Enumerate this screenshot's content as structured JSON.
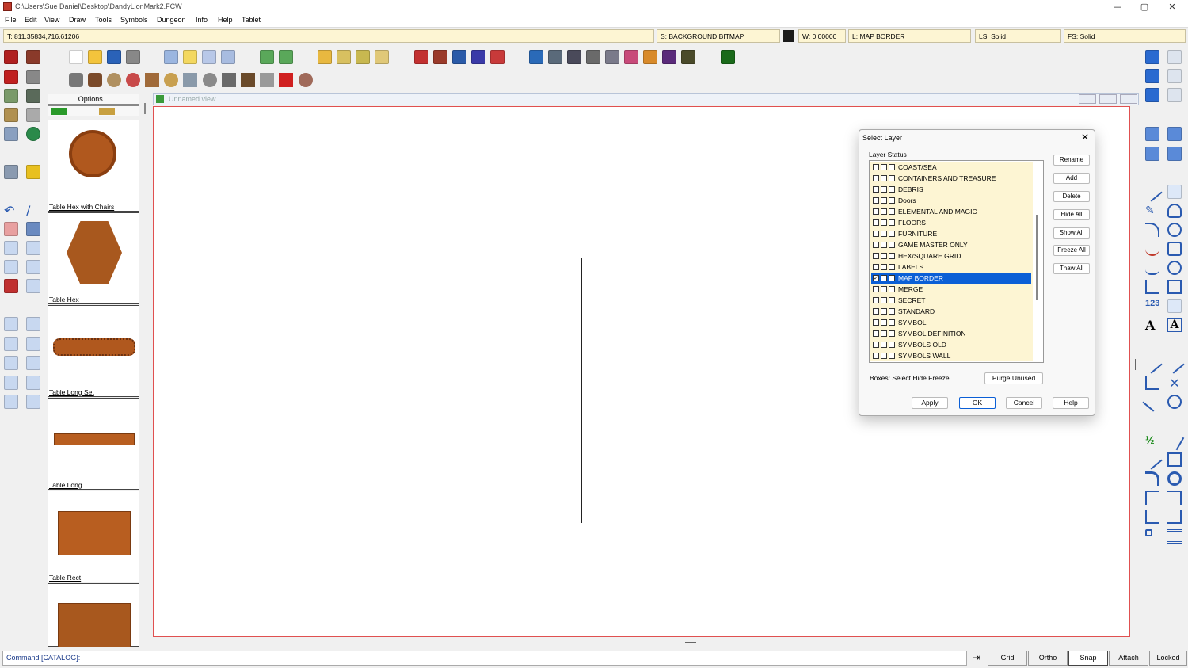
{
  "window": {
    "title": "C:\\Users\\Sue Daniel\\Desktop\\DandyLionMark2.FCW",
    "minimize": "—",
    "maximize": "▢",
    "close": "✕"
  },
  "menu": [
    "File",
    "Edit",
    "View",
    "Draw",
    "Tools",
    "Symbols",
    "Dungeon",
    "Info",
    "Help",
    "Tablet"
  ],
  "status": {
    "coords": "T: 811.35834,716.61206",
    "sheet": "S: BACKGROUND BITMAP",
    "width": "W: 0.00000",
    "layer": "L: MAP BORDER",
    "line_style": "LS: Solid",
    "fill_style": "FS: Solid",
    "color_swatch": "#1a1a1a"
  },
  "catalog": {
    "options_label": "Options...",
    "items": [
      "Table Hex with Chairs",
      "Table Hex",
      "Table Long Set",
      "Table Long",
      "Table Rect"
    ]
  },
  "view": {
    "title": "Unnamed view"
  },
  "dialog": {
    "title": "Select Layer",
    "group_label": "Layer Status",
    "layers": [
      "COAST/SEA",
      "CONTAINERS AND TREASURE",
      "DEBRIS",
      "Doors",
      "ELEMENTAL AND MAGIC",
      "FLOORS",
      "FURNITURE",
      "GAME MASTER ONLY",
      "HEX/SQUARE GRID",
      "LABELS",
      "MAP BORDER",
      "MERGE",
      "SECRET",
      "STANDARD",
      "SYMBOL",
      "SYMBOL DEFINITION",
      "SYMBOLS OLD",
      "SYMBOLS WALL"
    ],
    "selected_layer": "MAP BORDER",
    "side_buttons": [
      "Rename",
      "Add",
      "Delete",
      "Hide All",
      "Show All",
      "Freeze All",
      "Thaw All"
    ],
    "boxes_label": "Boxes: Select Hide Freeze",
    "purge_label": "Purge Unused",
    "bottom_buttons": [
      "Apply",
      "OK",
      "Cancel",
      "Help"
    ]
  },
  "command": {
    "prompt": "Command [CATALOG]:",
    "toggles": [
      "Grid",
      "Ortho",
      "Snap",
      "Attach",
      "Locked"
    ]
  }
}
